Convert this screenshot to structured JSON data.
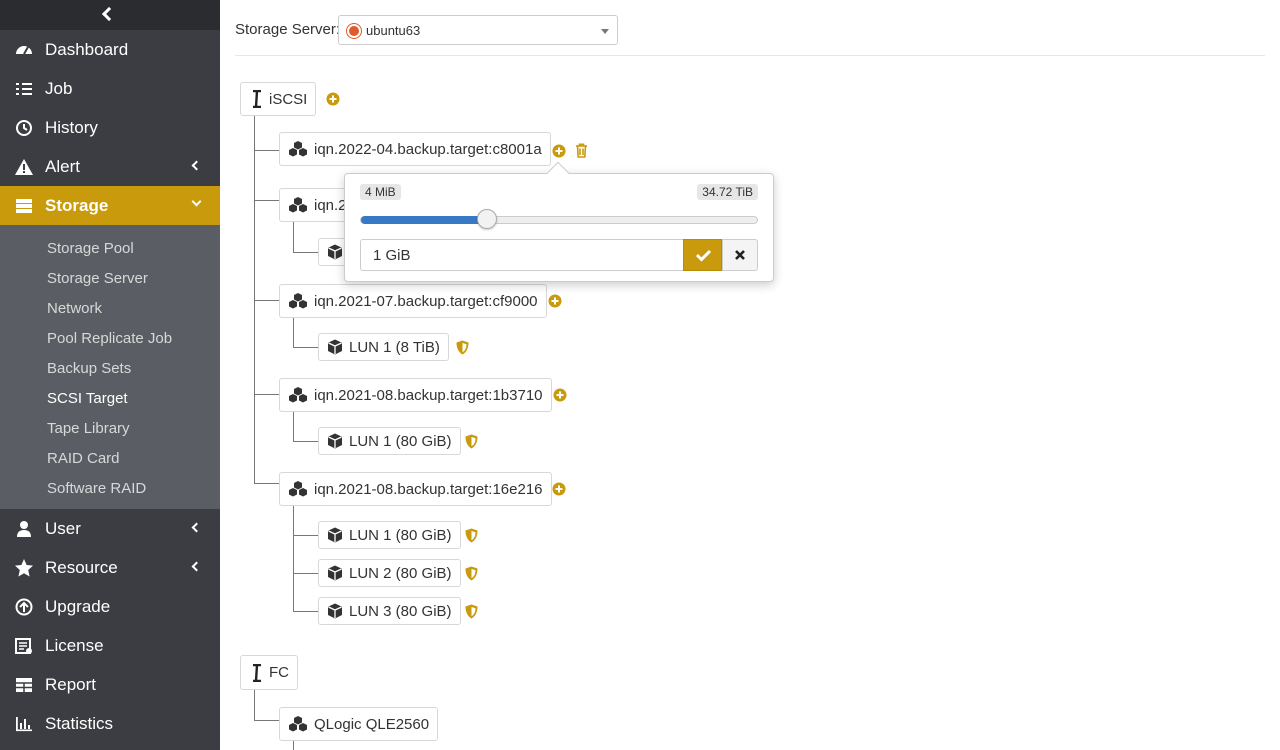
{
  "colors": {
    "accent": "#c99a0c",
    "sidebar_bg": "#3b3d42",
    "submenu_bg": "#5a5d63",
    "slider_fill": "#3879c6"
  },
  "sidebar": {
    "items": [
      {
        "label": "Dashboard",
        "icon": "dashboard-icon"
      },
      {
        "label": "Job",
        "icon": "list-icon"
      },
      {
        "label": "History",
        "icon": "history-icon"
      },
      {
        "label": "Alert",
        "icon": "warning-icon",
        "has_caret": true
      },
      {
        "label": "Storage",
        "icon": "storage-icon",
        "has_caret": true,
        "active": true
      },
      {
        "label": "User",
        "icon": "user-icon",
        "has_caret": true
      },
      {
        "label": "Resource",
        "icon": "star-icon",
        "has_caret": true
      },
      {
        "label": "Upgrade",
        "icon": "upgrade-icon"
      },
      {
        "label": "License",
        "icon": "license-icon"
      },
      {
        "label": "Report",
        "icon": "table-icon"
      },
      {
        "label": "Statistics",
        "icon": "bar-chart-icon"
      }
    ],
    "storage_sub": [
      "Storage Pool",
      "Storage Server",
      "Network",
      "Pool Replicate Job",
      "Backup Sets",
      "SCSI Target",
      "Tape Library",
      "RAID Card",
      "Software RAID"
    ],
    "storage_sub_current": "SCSI Target"
  },
  "server": {
    "label": "Storage Server:",
    "value": "ubuntu63"
  },
  "tree": {
    "iscsi_label": "iSCSI",
    "fc_label": "FC",
    "targets": [
      {
        "name": "iqn.2022-04.backup.target:c8001a"
      },
      {
        "name": "iqn.2"
      },
      {
        "name": "iqn.2021-07.backup.target:cf9000"
      },
      {
        "name": "iqn.2021-08.backup.target:1b3710"
      },
      {
        "name": "iqn.2021-08.backup.target:16e216"
      }
    ],
    "luns": [
      {
        "label": "LUN 1 (8 TiB)"
      },
      {
        "label": "LUN 1 (80 GiB)"
      },
      {
        "label": "LUN 1 (80 GiB)"
      },
      {
        "label": "LUN 2 (80 GiB)"
      },
      {
        "label": "LUN 3 (80 GiB)"
      }
    ],
    "fc_target": "QLogic QLE2560"
  },
  "popover": {
    "min_label": "4 MiB",
    "max_label": "34.72 TiB",
    "slider_fraction": 0.32,
    "input_value": "1 GiB"
  }
}
